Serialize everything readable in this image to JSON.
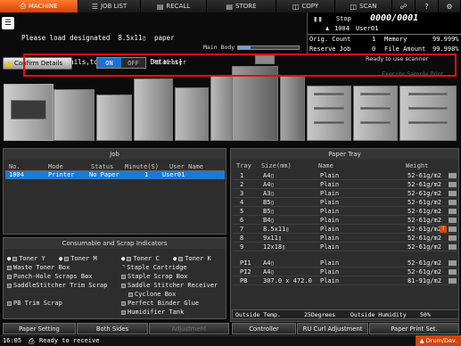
{
  "tabs": [
    {
      "label": "MACHINE",
      "icon": "printer-icon"
    },
    {
      "label": "JOB LIST",
      "icon": "list-icon"
    },
    {
      "label": "RECALL",
      "icon": "recall-icon"
    },
    {
      "label": "STORE",
      "icon": "store-icon"
    },
    {
      "label": "COPY",
      "icon": "copy-icon"
    },
    {
      "label": "SCAN",
      "icon": "scan-icon"
    }
  ],
  "message": {
    "line1": "Please load designated  8.5x11▯  paper",
    "line2": "To check details,touch [Confirm Details]"
  },
  "status": {
    "state": "Stop",
    "counter": "0000/0001",
    "job_number": "1004",
    "user": "User01",
    "orig_count_label": "Orig. Count",
    "orig_count_value": "1",
    "memory_label": "Memory",
    "memory_value": "99.999%",
    "reserve_job_label": "Reserve Job",
    "reserve_job_value": "0",
    "file_amount_label": "File Amount",
    "file_amount_value": "99.998%",
    "main_body_label": "Main Body",
    "main_body_fill": 0.2
  },
  "toolbar": {
    "confirm_details": "Confirm Details",
    "on": "ON",
    "off": "OFF",
    "pb_heater": "PB Heater",
    "ready_scanner": "Ready to use scanner",
    "execute_sample": "Execute Sample Print"
  },
  "job": {
    "title": "Job",
    "headers": [
      "No.",
      "Mode",
      "Status",
      "Minute(S)",
      "User Name"
    ],
    "rows": [
      [
        "1004",
        "Printer",
        "No Paper",
        "1",
        "User01"
      ]
    ]
  },
  "consumables": {
    "title": "Consumable and Scrap Indicators",
    "items": [
      "Toner Y",
      "Toner M",
      "Toner C",
      "Toner K",
      "Waste Toner Box",
      "Staple Cartridge",
      "Punch-Hole Scraps Box",
      "Staple Scrap Box",
      "SaddleStitcher Trim Scrap",
      "Saddle Stitcher Receiver",
      "Cyclone Box",
      "PB Trim Scrap",
      "Perfect Binder Glue",
      "Humidifier Tank"
    ]
  },
  "tray": {
    "title": "Paper Tray",
    "headers": [
      "Tray",
      "Size(mm)",
      "Name",
      "Weight"
    ],
    "rows": [
      {
        "tray": "1",
        "size": "A4▯",
        "name": "Plain",
        "weight": "52-61g/m2",
        "alert": false
      },
      {
        "tray": "2",
        "size": "A4▯",
        "name": "Plain",
        "weight": "52-61g/m2",
        "alert": false
      },
      {
        "tray": "3",
        "size": "A3▯",
        "name": "Plain",
        "weight": "52-61g/m2",
        "alert": false
      },
      {
        "tray": "4",
        "size": "B5▯",
        "name": "Plain",
        "weight": "52-61g/m2",
        "alert": false
      },
      {
        "tray": "5",
        "size": "B5▯",
        "name": "Plain",
        "weight": "52-61g/m2",
        "alert": false
      },
      {
        "tray": "6",
        "size": "B4▯",
        "name": "Plain",
        "weight": "52-61g/m2",
        "alert": false
      },
      {
        "tray": "7",
        "size": "8.5x11▯",
        "name": "Plain",
        "weight": "52-61g/m2",
        "alert": true
      },
      {
        "tray": "8",
        "size": "9x11▯",
        "name": "Plain",
        "weight": "52-61g/m2",
        "alert": false
      },
      {
        "tray": "9",
        "size": "12x18▯",
        "name": "Plain",
        "weight": "52-61g/m2",
        "alert": false
      },
      {
        "tray": "PI1",
        "size": "A4▯",
        "name": "Plain",
        "weight": "52-61g/m2",
        "alert": false
      },
      {
        "tray": "PI2",
        "size": "A4▯",
        "name": "Plain",
        "weight": "52-61g/m2",
        "alert": false
      },
      {
        "tray": "PB",
        "size": "307.0 x 472.0",
        "name": "Plain",
        "weight": "81-91g/m2",
        "alert": false
      }
    ],
    "outside_temp_label": "Outside Temp.",
    "outside_temp_value": "25Degrees",
    "outside_humidity_label": "Outside Humidity",
    "outside_humidity_value": "50%"
  },
  "bottom_buttons": [
    {
      "label": "Paper Setting",
      "enabled": true
    },
    {
      "label": "Both Sides",
      "enabled": true
    },
    {
      "label": "Adjustment",
      "enabled": false
    },
    {
      "label": "Controller",
      "enabled": true
    },
    {
      "label": "RU Curl Adjustment",
      "enabled": true
    },
    {
      "label": "Paper Print Set.",
      "enabled": true
    }
  ],
  "statusline": {
    "time": "16:05",
    "text": "Ready to receive",
    "badge": "Drum/Dev."
  },
  "colors": {
    "active_tab": "#e8561a",
    "selection": "#1d79d6",
    "alert": "#e01010"
  }
}
